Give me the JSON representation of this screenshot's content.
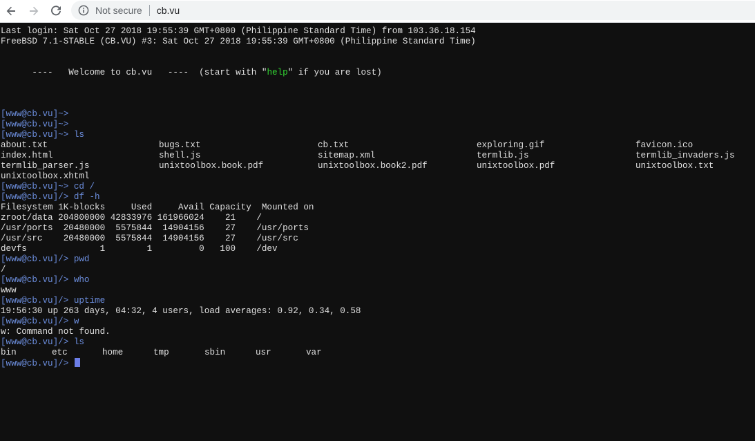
{
  "browser": {
    "security_label": "Not secure",
    "url": "cb.vu"
  },
  "terminal": {
    "login_line": "Last login: Sat Oct 27 2018 19:55:39 GMT+0800 (Philippine Standard Time) from 103.36.18.154",
    "system_line": "FreeBSD 7.1-STABLE (CB.VU) #3: Sat Oct 27 2018 19:55:39 GMT+0800 (Philippine Standard Time)",
    "welcome": {
      "before": "      ----   Welcome to cb.vu   ----  (start with \"",
      "help_word": "help",
      "after": "\" if you are lost)"
    },
    "prompt_home": "[www@cb.vu]~> ",
    "prompt_root": "[www@cb.vu]/> ",
    "commands": {
      "ls": "ls",
      "cd": "cd /",
      "df": "df -h",
      "pwd": "pwd",
      "who": "who",
      "uptime": "uptime",
      "w": "w",
      "ls2": "ls"
    },
    "ls_home_rows": [
      [
        "about.txt",
        "bugs.txt",
        "cb.txt",
        "exploring.gif",
        "favicon.ico"
      ],
      [
        "index.html",
        "shell.js",
        "sitemap.xml",
        "termlib.js",
        "termlib_invaders.js"
      ],
      [
        "termlib_parser.js",
        "unixtoolbox.book.pdf",
        "unixtoolbox.book2.pdf",
        "unixtoolbox.pdf",
        "unixtoolbox.txt"
      ],
      [
        "unixtoolbox.xhtml"
      ]
    ],
    "df_lines": [
      "Filesystem 1K-blocks     Used     Avail Capacity  Mounted on",
      "zroot/data 204800000 42833976 161966024    21    /",
      "/usr/ports  20480000  5575844  14904156    27    /usr/ports",
      "/usr/src    20480000  5575844  14904156    27    /usr/src",
      "devfs              1        1         0   100    /dev"
    ],
    "pwd_output": "/",
    "who_output": "www",
    "uptime_output": "19:56:30 up 263 days, 04:32, 4 users, load averages: 0.92, 0.34, 0.58",
    "w_output": "w: Command not found.",
    "ls_root": [
      "bin",
      "etc",
      "home",
      "tmp",
      "sbin",
      "usr",
      "var"
    ]
  }
}
